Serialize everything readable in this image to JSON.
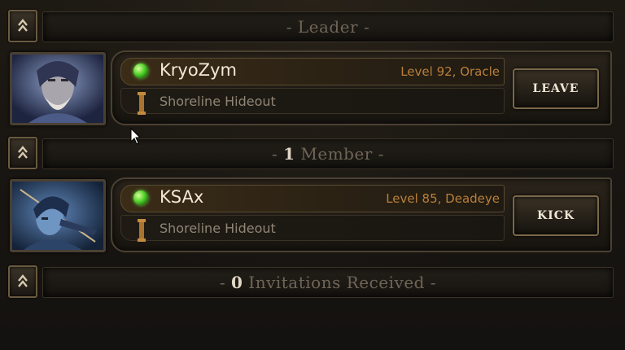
{
  "sections": {
    "leader": {
      "label": "Leader"
    },
    "members": {
      "count": "1",
      "label": "Member"
    },
    "invitations": {
      "count": "0",
      "label": "Invitations Received"
    }
  },
  "leader": {
    "name": "KryoZym",
    "level_class": "Level 92, Oracle",
    "location": "Shoreline Hideout",
    "action_label": "LEAVE",
    "status": "online"
  },
  "member": {
    "name": "KSAx",
    "level_class": "Level 85, Deadeye",
    "location": "Shoreline Hideout",
    "action_label": "KICK",
    "status": "online"
  },
  "icons": {
    "collapse": "chevron-up-icon",
    "online": "online-status-icon",
    "badge": "location-badge-icon"
  },
  "colors": {
    "accent": "#b97f3a",
    "online": "#4fd12a",
    "text": "#f2e8d6"
  }
}
